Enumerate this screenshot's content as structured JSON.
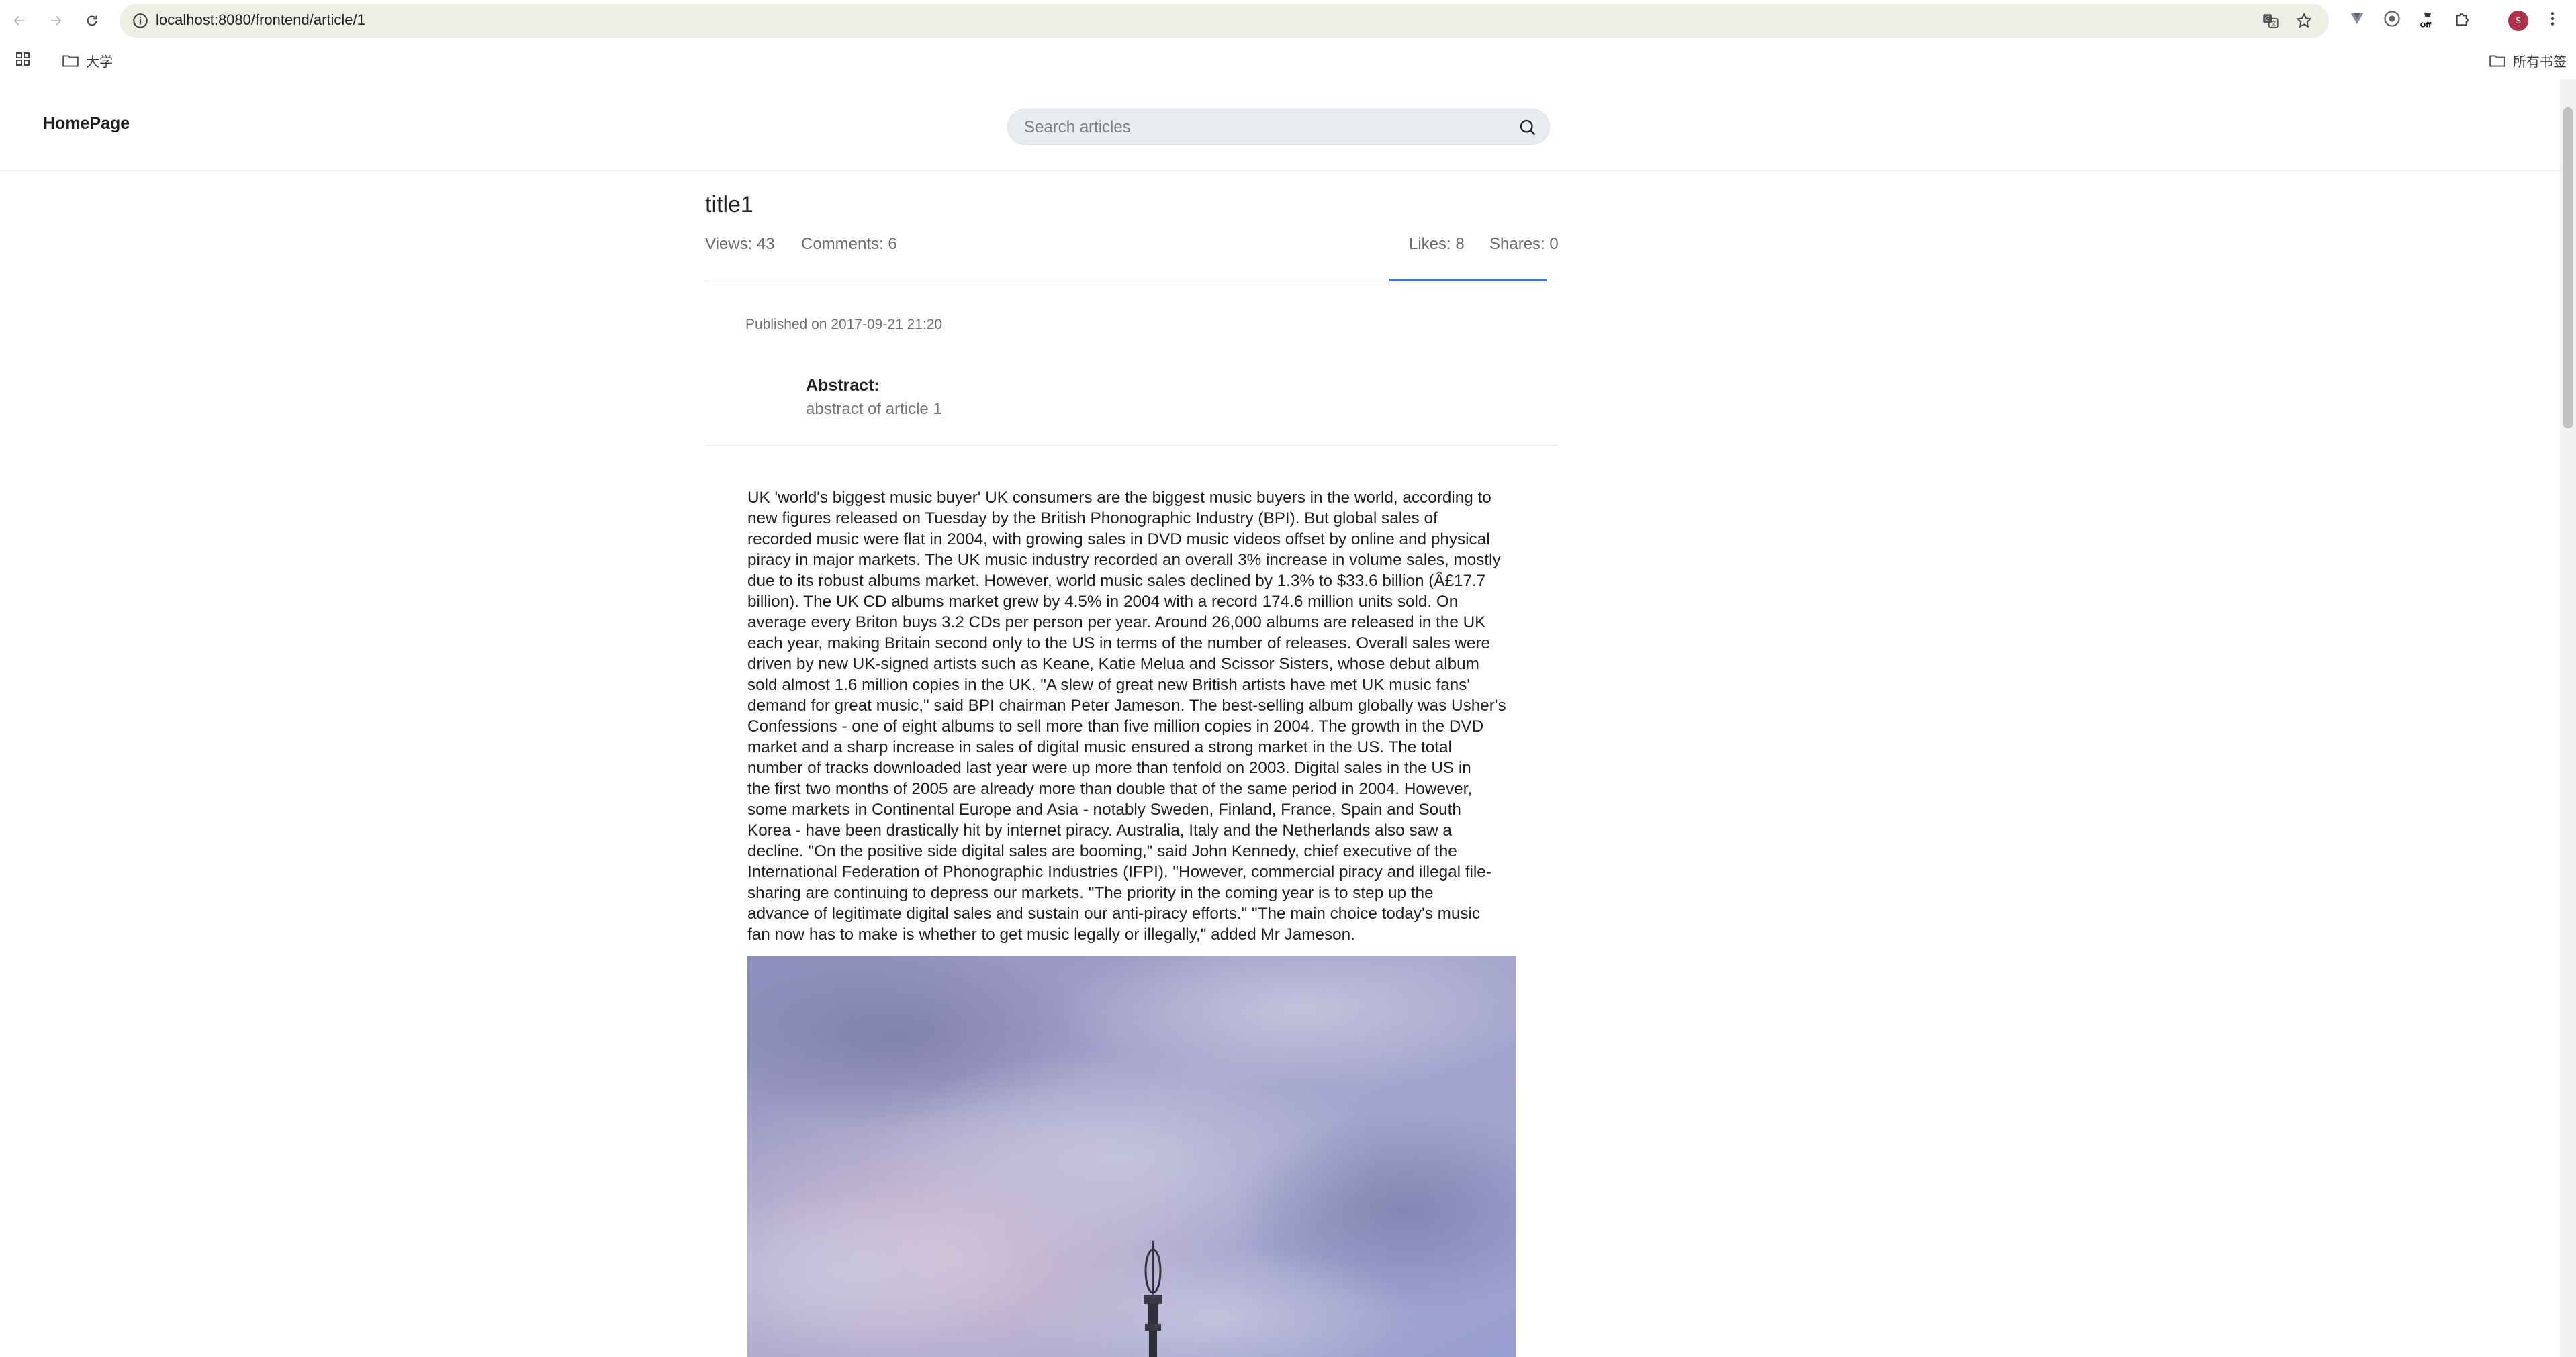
{
  "browser": {
    "url": "localhost:8080/frontend/article/1",
    "bookmarks": [
      {
        "label": "大学",
        "icon": "folder-icon"
      }
    ],
    "all_bookmarks_label": "所有书签",
    "profile_initial": "S"
  },
  "header": {
    "brand": "HomePage",
    "search_placeholder": "Search articles"
  },
  "article": {
    "title": "title1",
    "views": "Views: 43",
    "comments": "Comments: 6",
    "likes": "Likes: 8",
    "shares": "Shares: 0",
    "published": "Published on 2017-09-21 21:20",
    "abstract_label": "Abstract:",
    "abstract_text": "abstract of article 1",
    "body_lines": [
      "UK 'world's biggest music buyer' UK consumers are the biggest music buyers in the world, according to",
      "new figures released on Tuesday by the British Phonographic Industry (BPI). But global sales of",
      "recorded music were flat in 2004, with growing sales in DVD music videos offset by online and physical",
      "piracy in major markets. The UK music industry recorded an overall 3% increase in volume sales, mostly",
      "due to its robust albums market. However, world music sales declined by 1.3% to $33.6 billion (Â£17.7",
      "billion). The UK CD albums market grew by 4.5% in 2004 with a record 174.6 million units sold. On",
      "average every Briton buys 3.2 CDs per person per year. Around 26,000 albums are released in the UK",
      "each year, making Britain second only to the US in terms of the number of releases. Overall sales were",
      "driven by new UK-signed artists such as Keane, Katie Melua and Scissor Sisters, whose debut album",
      "sold almost 1.6 million copies in the UK. \"A slew of great new British artists have met UK music fans'",
      "demand for great music,\" said BPI chairman Peter Jameson. The best-selling album globally was Usher's",
      "Confessions - one of eight albums to sell more than five million copies in 2004. The growth in the DVD",
      "market and a sharp increase in sales of digital music ensured a strong market in the US. The total",
      "number of tracks downloaded last year were up more than tenfold on 2003. Digital sales in the US in",
      "the first two months of 2005 are already more than double that of the same period in 2004. However,",
      "some markets in Continental Europe and Asia - notably Sweden, Finland, France, Spain and South",
      "Korea - have been drastically hit by internet piracy. Australia, Italy and the Netherlands also saw a",
      "decline. \"On the positive side digital sales are booming,\" said John Kennedy, chief executive of the",
      "International Federation of Phonographic Industries (IFPI). \"However, commercial piracy and illegal file-",
      "sharing are continuing to depress our markets. \"The priority in the coming year is to step up the",
      "advance of legitimate digital sales and sustain our anti-piracy efforts.\" \"The main choice today's music",
      "fan now has to make is whether to get music legally or illegally,\" added Mr Jameson."
    ]
  },
  "colors": {
    "accent": "#4a6fd6",
    "omnibox_bg": "#eef0e6",
    "search_bg": "#e8ecee",
    "avatar": "#b0314a"
  }
}
